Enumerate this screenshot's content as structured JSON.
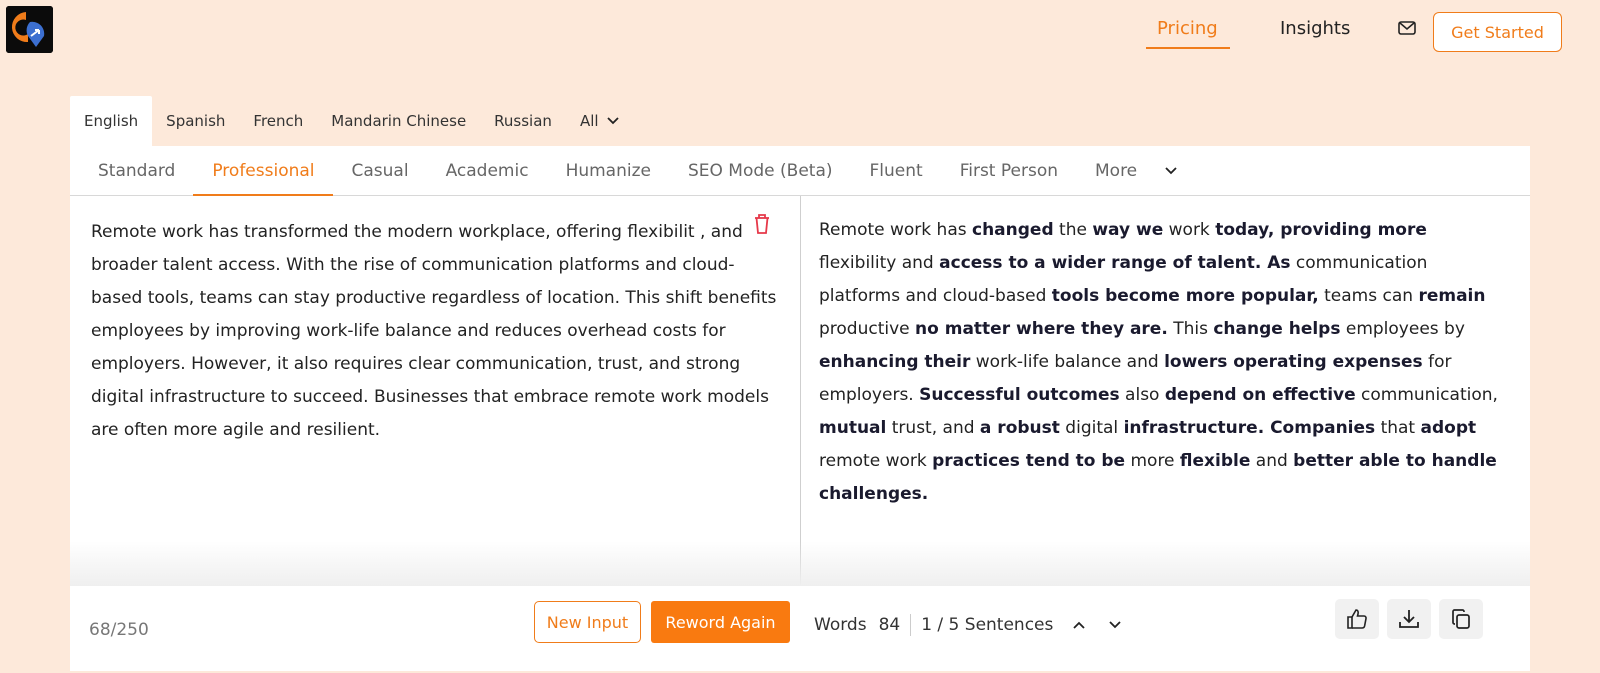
{
  "header": {
    "nav": [
      {
        "label": "Pricing",
        "active": true
      },
      {
        "label": "Insights",
        "active": false
      }
    ],
    "mail_icon": "mail-icon",
    "cta_label": "Get Started"
  },
  "language_tabs": [
    {
      "label": "English",
      "active": true
    },
    {
      "label": "Spanish",
      "active": false
    },
    {
      "label": "French",
      "active": false
    },
    {
      "label": "Mandarin Chinese",
      "active": false
    },
    {
      "label": "Russian",
      "active": false
    },
    {
      "label": "All",
      "active": false
    }
  ],
  "mode_tabs": [
    {
      "label": "Standard",
      "active": false
    },
    {
      "label": "Professional",
      "active": true
    },
    {
      "label": "Casual",
      "active": false
    },
    {
      "label": "Academic",
      "active": false
    },
    {
      "label": "Humanize",
      "active": false
    },
    {
      "label": "SEO Mode (Beta)",
      "active": false
    },
    {
      "label": "Fluent",
      "active": false
    },
    {
      "label": "First Person",
      "active": false
    },
    {
      "label": "More",
      "active": false
    }
  ],
  "input": {
    "text": "Remote work has transformed the modern workplace, offering flexibilit , and broader talent access. With the rise of communication platforms and cloud-based tools, teams can stay productive regardless of location. This shift benefits employees by improving work-life balance and reduces overhead costs for employers. However, it also requires clear communication, trust, and strong digital infrastructure to succeed. Businesses that embrace remote work models are often more agile and resilient.",
    "word_counter": "68/250",
    "new_input_label": "New Input",
    "reword_label": "Reword Again"
  },
  "output": {
    "segments": [
      {
        "t": "Remote work has ",
        "b": false
      },
      {
        "t": "changed",
        "b": true
      },
      {
        "t": " the ",
        "b": false
      },
      {
        "t": "way we",
        "b": true
      },
      {
        "t": " work ",
        "b": false
      },
      {
        "t": "today, providing more",
        "b": true
      },
      {
        "t": " flexibility and ",
        "b": false
      },
      {
        "t": "access to a wider range of talent. As",
        "b": true
      },
      {
        "t": " communication platforms and cloud-based ",
        "b": false
      },
      {
        "t": "tools become more popular,",
        "b": true
      },
      {
        "t": " teams can ",
        "b": false
      },
      {
        "t": "remain",
        "b": true
      },
      {
        "t": " productive ",
        "b": false
      },
      {
        "t": "no matter where they are.",
        "b": true
      },
      {
        "t": " This ",
        "b": false
      },
      {
        "t": "change helps",
        "b": true
      },
      {
        "t": " employees by ",
        "b": false
      },
      {
        "t": "enhancing their",
        "b": true
      },
      {
        "t": " work-life balance and ",
        "b": false
      },
      {
        "t": "lowers operating expenses",
        "b": true
      },
      {
        "t": " for employers. ",
        "b": false
      },
      {
        "t": "Successful outcomes",
        "b": true
      },
      {
        "t": " also ",
        "b": false
      },
      {
        "t": "depend on effective",
        "b": true
      },
      {
        "t": " communication, ",
        "b": false
      },
      {
        "t": "mutual",
        "b": true
      },
      {
        "t": " trust, and ",
        "b": false
      },
      {
        "t": "a robust",
        "b": true
      },
      {
        "t": " digital ",
        "b": false
      },
      {
        "t": "infrastructure. Companies",
        "b": true
      },
      {
        "t": " that ",
        "b": false
      },
      {
        "t": "adopt",
        "b": true
      },
      {
        "t": " remote work ",
        "b": false
      },
      {
        "t": "practices tend to be",
        "b": true
      },
      {
        "t": " more ",
        "b": false
      },
      {
        "t": "flexible",
        "b": true
      },
      {
        "t": " and ",
        "b": false
      },
      {
        "t": "better able to handle challenges.",
        "b": true
      }
    ],
    "words_label": "Words",
    "words_count": "84",
    "sentences_label": "1 / 5 Sentences"
  },
  "colors": {
    "accent": "#f07c1a",
    "background": "#fde9da"
  }
}
